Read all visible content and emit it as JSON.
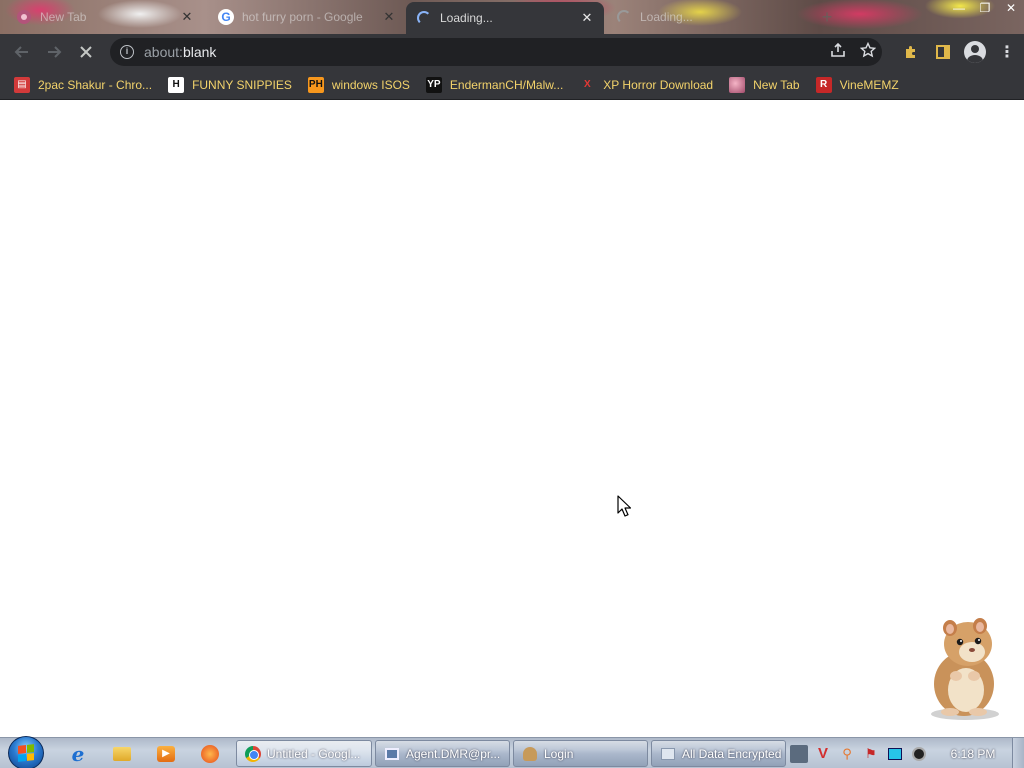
{
  "browser": {
    "tabs": [
      {
        "title": "New Tab",
        "favicon": "newtab-icon",
        "state": "inactive"
      },
      {
        "title": "hot furry porn - Google",
        "favicon": "google-icon",
        "state": "inactive"
      },
      {
        "title": "Loading...",
        "favicon": "loading-spinner-icon",
        "state": "active"
      },
      {
        "title": "Loading...",
        "favicon": "loading-spinner-icon",
        "state": "inactive"
      }
    ],
    "new_tab_label": "+",
    "address_bar": {
      "scheme": "about:",
      "path": "blank"
    },
    "bookmarks": [
      {
        "label": "2pac Shakur - Chro...",
        "icon": "2pac-icon"
      },
      {
        "label": "FUNNY SNIPPIES",
        "icon": "h-icon"
      },
      {
        "label": "windows ISOS",
        "icon": "ph-icon"
      },
      {
        "label": "EndermanCH/Malw...",
        "icon": "yt-icon"
      },
      {
        "label": "XP Horror Download",
        "icon": "x-icon"
      },
      {
        "label": "New Tab",
        "icon": "newtab-icon"
      },
      {
        "label": "VineMEMZ",
        "icon": "r-icon"
      }
    ]
  },
  "taskbar": {
    "tasks": [
      {
        "label": "Untitled - Googl...",
        "icon": "chrome-icon",
        "active": true
      },
      {
        "label": "Agent.DMR@pr...",
        "icon": "window-icon",
        "active": false
      },
      {
        "label": "Login",
        "icon": "login-icon",
        "active": false
      },
      {
        "label": "All Data Encrypted",
        "icon": "data-icon",
        "active": false
      }
    ],
    "clock": "6:18 PM"
  },
  "glyphs": {
    "ph": "PH",
    "yt": "YP",
    "h": "H",
    "x": "X",
    "r": "R"
  },
  "colors": {
    "browser_frame": "#35363a",
    "omnibox": "#202124",
    "bookmark_text": "#f3d36b",
    "page_bg": "#ffffff"
  }
}
